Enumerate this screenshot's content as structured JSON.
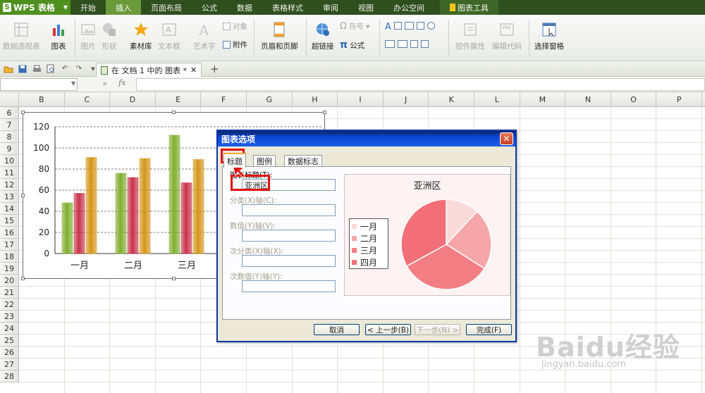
{
  "app": {
    "name": "WPS 表格",
    "menu_tabs": [
      "开始",
      "插入",
      "页面布局",
      "公式",
      "数据",
      "表格样式",
      "审阅",
      "视图",
      "办公空间"
    ],
    "active_tab": "插入",
    "context_tab": "图表工具"
  },
  "ribbon": {
    "pivot": "数据透视表",
    "chart": "图表",
    "picture": "图片",
    "shape": "形状",
    "material": "素材库",
    "textbox": "文本框",
    "wordart": "艺术字",
    "object": "对象",
    "attachment": "附件",
    "header_footer": "页眉和页脚",
    "hyperlink": "超链接",
    "symbol": "符号",
    "formula": "公式",
    "control_props": "控件属性",
    "edit_code": "编辑代码",
    "selection_pane": "选择窗格"
  },
  "document_tab": {
    "label": "在 文档 1 中的 图表 *"
  },
  "formula_bar": {
    "name_box": "",
    "fx": "fx",
    "content": ""
  },
  "sheet": {
    "columns": [
      "B",
      "C",
      "D",
      "E",
      "F",
      "G",
      "H",
      "I",
      "J",
      "K",
      "L",
      "M",
      "N",
      "O",
      "P"
    ],
    "rows": [
      "6",
      "7",
      "8",
      "9",
      "10",
      "11",
      "12",
      "13",
      "14",
      "15",
      "16",
      "17",
      "18",
      "19",
      "20",
      "21",
      "22",
      "23",
      "24",
      "25",
      "26",
      "27",
      "28"
    ]
  },
  "chart_data": {
    "type": "bar",
    "categories": [
      "一月",
      "二月",
      "三月"
    ],
    "series": [
      {
        "color": "#7fae2e",
        "values": [
          48,
          76,
          112
        ]
      },
      {
        "color": "#c8324a",
        "values": [
          57,
          72,
          67
        ]
      },
      {
        "color": "#d49519",
        "values": [
          91,
          90,
          89
        ]
      }
    ],
    "ylim": [
      0,
      120
    ],
    "yticks": [
      0,
      20,
      40,
      60,
      80,
      100,
      120
    ],
    "grid": true
  },
  "dialog": {
    "title": "图表选项",
    "tabs": [
      "标题",
      "图例",
      "数据标志"
    ],
    "active_tab": "标题",
    "fields": [
      {
        "label": "图表标题(T):",
        "value": "亚洲区",
        "enabled": true
      },
      {
        "label": "分类(X)轴(C):",
        "value": "",
        "enabled": false
      },
      {
        "label": "数值(Y)轴(V):",
        "value": "",
        "enabled": false
      },
      {
        "label": "次分类(X)轴(X):",
        "value": "",
        "enabled": false
      },
      {
        "label": "次数值(Y)轴(Y):",
        "value": "",
        "enabled": false
      }
    ],
    "buttons": {
      "cancel": "取消",
      "back": "< 上一步(B)",
      "next": "下一步(N) >",
      "finish": "完成(F)"
    },
    "preview": {
      "title": "亚洲区",
      "pie": {
        "type": "pie",
        "categories": [
          "一月",
          "二月",
          "三月",
          "四月"
        ],
        "values": [
          12,
          22,
          33,
          33
        ],
        "colors": [
          "#fbdada",
          "#f5a6a8",
          "#f27e84",
          "#f26f77"
        ]
      }
    }
  },
  "watermark": {
    "brand": "Baidu经验",
    "url": "jingyan.baidu.com"
  }
}
